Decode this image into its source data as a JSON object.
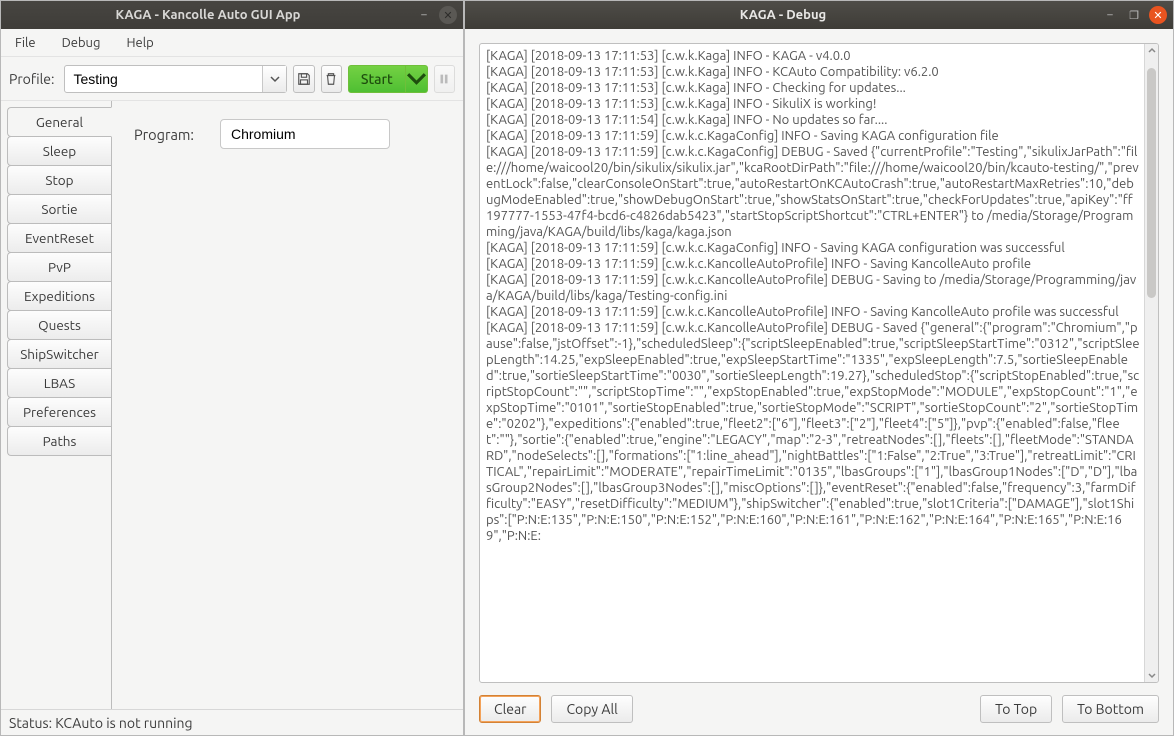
{
  "left_window": {
    "title": "KAGA - Kancolle Auto GUI App",
    "menu": {
      "file": "File",
      "debug": "Debug",
      "help": "Help"
    },
    "profile": {
      "label": "Profile:",
      "value": "Testing",
      "start_label": "Start"
    },
    "tabs": {
      "general": "General",
      "sleep": "Sleep",
      "stop": "Stop",
      "sortie": "Sortie",
      "event_reset": "EventReset",
      "pvp": "PvP",
      "expeditions": "Expeditions",
      "quests": "Quests",
      "ship_switcher": "ShipSwitcher",
      "lbas": "LBAS",
      "preferences": "Preferences",
      "paths": "Paths"
    },
    "general_panel": {
      "program_label": "Program:",
      "program_value": "Chromium"
    },
    "status": "Status: KCAuto is not running"
  },
  "right_window": {
    "title": "KAGA - Debug",
    "log_text": "[KAGA] [2018-09-13 17:11:53] [c.w.k.Kaga] INFO - KAGA - v4.0.0\n[KAGA] [2018-09-13 17:11:53] [c.w.k.Kaga] INFO - KCAuto Compatibility: v6.2.0\n[KAGA] [2018-09-13 17:11:53] [c.w.k.Kaga] INFO - Checking for updates...\n[KAGA] [2018-09-13 17:11:53] [c.w.k.Kaga] INFO - SikuliX is working!\n[KAGA] [2018-09-13 17:11:54] [c.w.k.Kaga] INFO - No updates so far....\n[KAGA] [2018-09-13 17:11:59] [c.w.k.c.KagaConfig] INFO - Saving KAGA configuration file\n[KAGA] [2018-09-13 17:11:59] [c.w.k.c.KagaConfig] DEBUG - Saved {\"currentProfile\":\"Testing\",\"sikulixJarPath\":\"file:///home/waicool20/bin/sikulix/sikulix.jar\",\"kcaRootDirPath\":\"file:///home/waicool20/bin/kcauto-testing/\",\"preventLock\":false,\"clearConsoleOnStart\":true,\"autoRestartOnKCAutoCrash\":true,\"autoRestartMaxRetries\":10,\"debugModeEnabled\":true,\"showDebugOnStart\":true,\"showStatsOnStart\":true,\"checkForUpdates\":true,\"apiKey\":\"ff197777-1553-47f4-bcd6-c4826dab5423\",\"startStopScriptShortcut\":\"CTRL+ENTER\"} to /media/Storage/Programming/java/KAGA/build/libs/kaga/kaga.json\n[KAGA] [2018-09-13 17:11:59] [c.w.k.c.KagaConfig] INFO - Saving KAGA configuration was successful\n[KAGA] [2018-09-13 17:11:59] [c.w.k.c.KancolleAutoProfile] INFO - Saving KancolleAuto profile\n[KAGA] [2018-09-13 17:11:59] [c.w.k.c.KancolleAutoProfile] DEBUG - Saving to /media/Storage/Programming/java/KAGA/build/libs/kaga/Testing-config.ini\n[KAGA] [2018-09-13 17:11:59] [c.w.k.c.KancolleAutoProfile] INFO - Saving KancolleAuto profile was successful\n[KAGA] [2018-09-13 17:11:59] [c.w.k.c.KancolleAutoProfile] DEBUG - Saved {\"general\":{\"program\":\"Chromium\",\"pause\":false,\"jstOffset\":-1},\"scheduledSleep\":{\"scriptSleepEnabled\":true,\"scriptSleepStartTime\":\"0312\",\"scriptSleepLength\":14.25,\"expSleepEnabled\":true,\"expSleepStartTime\":\"1335\",\"expSleepLength\":7.5,\"sortieSleepEnabled\":true,\"sortieSleepStartTime\":\"0030\",\"sortieSleepLength\":19.27},\"scheduledStop\":{\"scriptStopEnabled\":true,\"scriptStopCount\":\"\",\"scriptStopTime\":\"\",\"expStopEnabled\":true,\"expStopMode\":\"MODULE\",\"expStopCount\":\"1\",\"expStopTime\":\"0101\",\"sortieStopEnabled\":true,\"sortieStopMode\":\"SCRIPT\",\"sortieStopCount\":\"2\",\"sortieStopTime\":\"0202\"},\"expeditions\":{\"enabled\":true,\"fleet2\":[\"6\"],\"fleet3\":[\"2\"],\"fleet4\":[\"5\"]},\"pvp\":{\"enabled\":false,\"fleet\":\"\"},\"sortie\":{\"enabled\":true,\"engine\":\"LEGACY\",\"map\":\"2-3\",\"retreatNodes\":[],\"fleets\":[],\"fleetMode\":\"STANDARD\",\"nodeSelects\":[],\"formations\":[\"1:line_ahead\"],\"nightBattles\":[\"1:False\",\"2:True\",\"3:True\"],\"retreatLimit\":\"CRITICAL\",\"repairLimit\":\"MODERATE\",\"repairTimeLimit\":\"0135\",\"lbasGroups\":[\"1\"],\"lbasGroup1Nodes\":[\"D\",\"D\"],\"lbasGroup2Nodes\":[],\"lbasGroup3Nodes\":[],\"miscOptions\":[]},\"eventReset\":{\"enabled\":false,\"frequency\":3,\"farmDifficulty\":\"EASY\",\"resetDifficulty\":\"MEDIUM\"},\"shipSwitcher\":{\"enabled\":true,\"slot1Criteria\":[\"DAMAGE\"],\"slot1Ships\":[\"P:N:E:135\",\"P:N:E:150\",\"P:N:E:152\",\"P:N:E:160\",\"P:N:E:161\",\"P:N:E:162\",\"P:N:E:164\",\"P:N:E:165\",\"P:N:E:169\",\"P:N:E:",
    "buttons": {
      "clear": "Clear",
      "copy_all": "Copy All",
      "to_top": "To Top",
      "to_bottom": "To Bottom"
    }
  }
}
